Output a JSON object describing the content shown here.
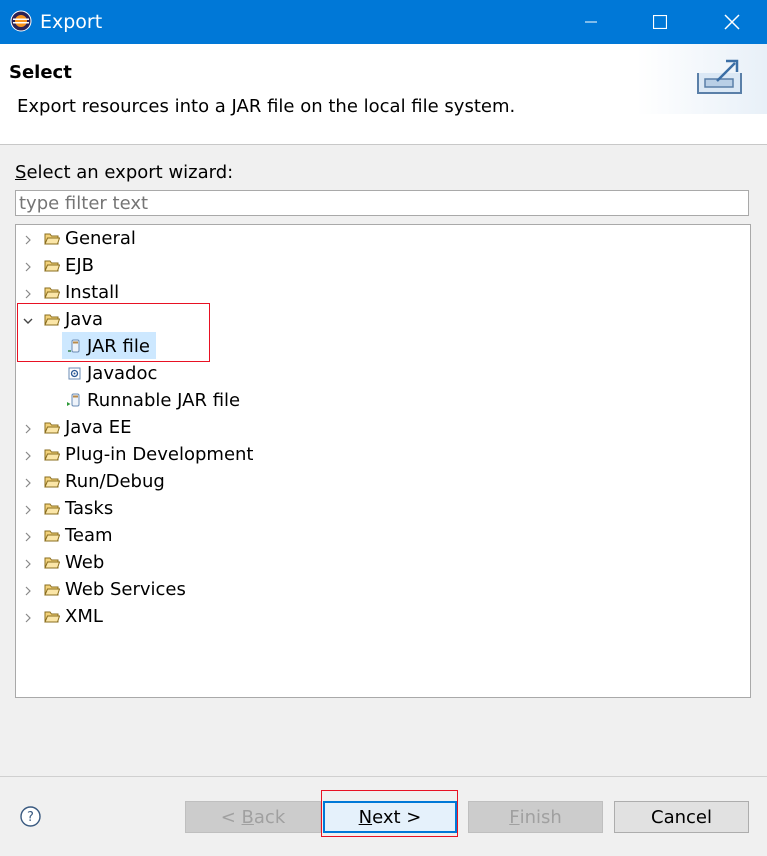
{
  "window": {
    "title": "Export"
  },
  "header": {
    "title": "Select",
    "description": "Export resources into a JAR file on the local file system."
  },
  "wizard": {
    "label_mnemonic": "S",
    "label_rest": "elect an export wizard:",
    "filter_placeholder": "type filter text",
    "tree": [
      {
        "label": "General",
        "expanded": false,
        "icon": "folder-icon"
      },
      {
        "label": "EJB",
        "expanded": false,
        "icon": "folder-icon"
      },
      {
        "label": "Install",
        "expanded": false,
        "icon": "folder-icon"
      },
      {
        "label": "Java",
        "expanded": true,
        "icon": "folder-open-icon",
        "children": [
          {
            "label": "JAR file",
            "icon": "jar-icon",
            "selected": true
          },
          {
            "label": "Javadoc",
            "icon": "javadoc-icon"
          },
          {
            "label": "Runnable JAR file",
            "icon": "runnable-jar-icon"
          }
        ]
      },
      {
        "label": "Java EE",
        "expanded": false,
        "icon": "folder-icon"
      },
      {
        "label": "Plug-in Development",
        "expanded": false,
        "icon": "folder-icon"
      },
      {
        "label": "Run/Debug",
        "expanded": false,
        "icon": "folder-icon"
      },
      {
        "label": "Tasks",
        "expanded": false,
        "icon": "folder-icon"
      },
      {
        "label": "Team",
        "expanded": false,
        "icon": "folder-icon"
      },
      {
        "label": "Web",
        "expanded": false,
        "icon": "folder-icon"
      },
      {
        "label": "Web Services",
        "expanded": false,
        "icon": "folder-icon"
      },
      {
        "label": "XML",
        "expanded": false,
        "icon": "folder-icon"
      }
    ]
  },
  "buttons": {
    "back": {
      "prefix": "< ",
      "mnemonic": "B",
      "rest": "ack"
    },
    "next": {
      "mnemonic": "N",
      "rest": "ext >"
    },
    "finish": {
      "mnemonic": "F",
      "rest": "inish"
    },
    "cancel": {
      "label": "Cancel"
    }
  },
  "colors": {
    "titlebar": "#0078d7",
    "selection": "#cde8ff",
    "highlight": "#e81123"
  }
}
